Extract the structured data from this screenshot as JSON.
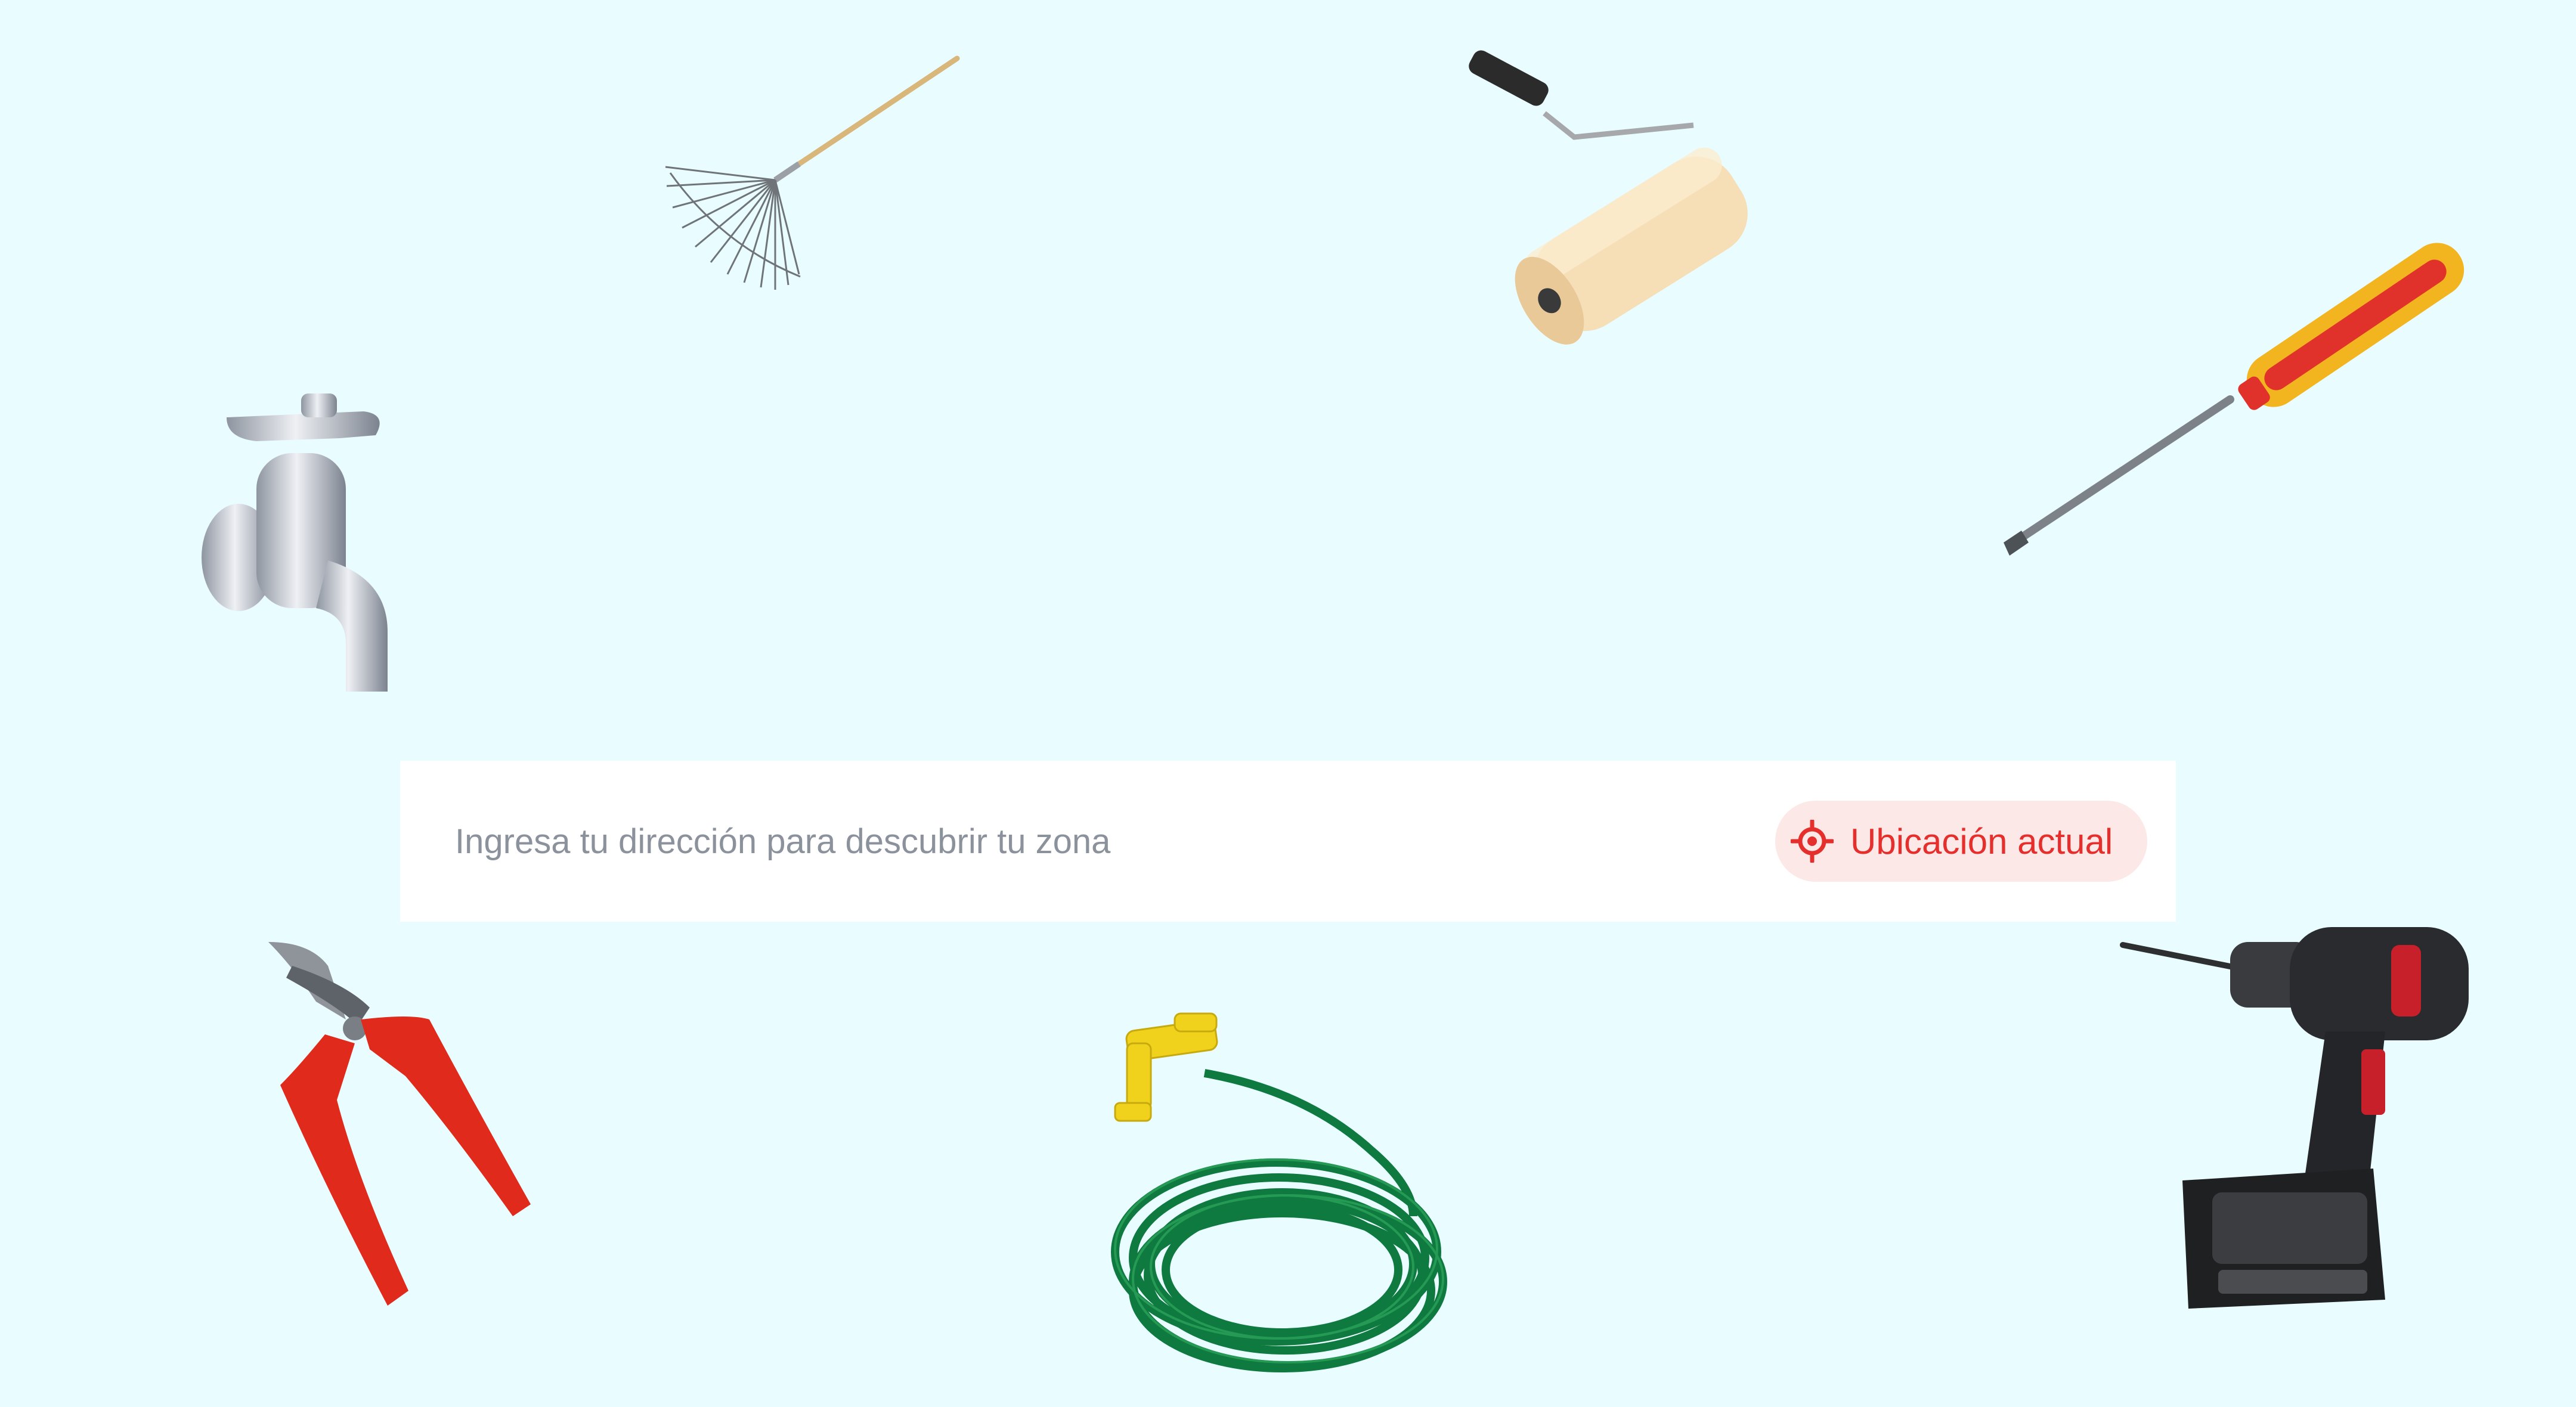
{
  "search": {
    "placeholder": "Ingresa tu dirección para descubrir tu zona",
    "value": ""
  },
  "location_button": {
    "label": "Ubicación actual",
    "icon": "crosshair-icon"
  },
  "colors": {
    "background": "#e9fcff",
    "accent": "#e52f2d",
    "accent_bg": "#fde8e8",
    "placeholder": "#8b929c"
  },
  "decorations": [
    {
      "icon": "rake-icon"
    },
    {
      "icon": "paint-roller-icon"
    },
    {
      "icon": "faucet-icon"
    },
    {
      "icon": "screwdriver-icon"
    },
    {
      "icon": "pliers-icon"
    },
    {
      "icon": "garden-hose-icon"
    },
    {
      "icon": "cordless-drill-icon"
    }
  ]
}
